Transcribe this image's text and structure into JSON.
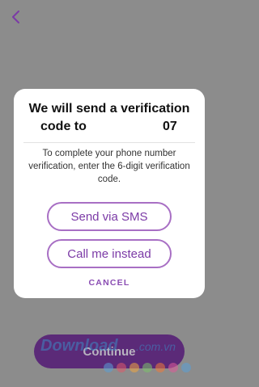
{
  "nav": {
    "back_icon": "chevron-left-icon"
  },
  "dialog": {
    "title_line1": "We will send a verification",
    "title_line2_left": "code to",
    "title_line2_right": "07",
    "message": "To complete your phone number verification, enter the 6-digit verification code.",
    "sms_label": "Send via SMS",
    "call_label": "Call me instead",
    "cancel_label": "CANCEL"
  },
  "footer": {
    "continue_label": "Continue"
  },
  "watermark": {
    "text": "Download.com.vn"
  },
  "colors": {
    "backdrop": "#8c8c8c",
    "accent_purple": "#7b3aa6",
    "pill_border": "#a86fc4",
    "continue_bg": "#5b2a78"
  }
}
